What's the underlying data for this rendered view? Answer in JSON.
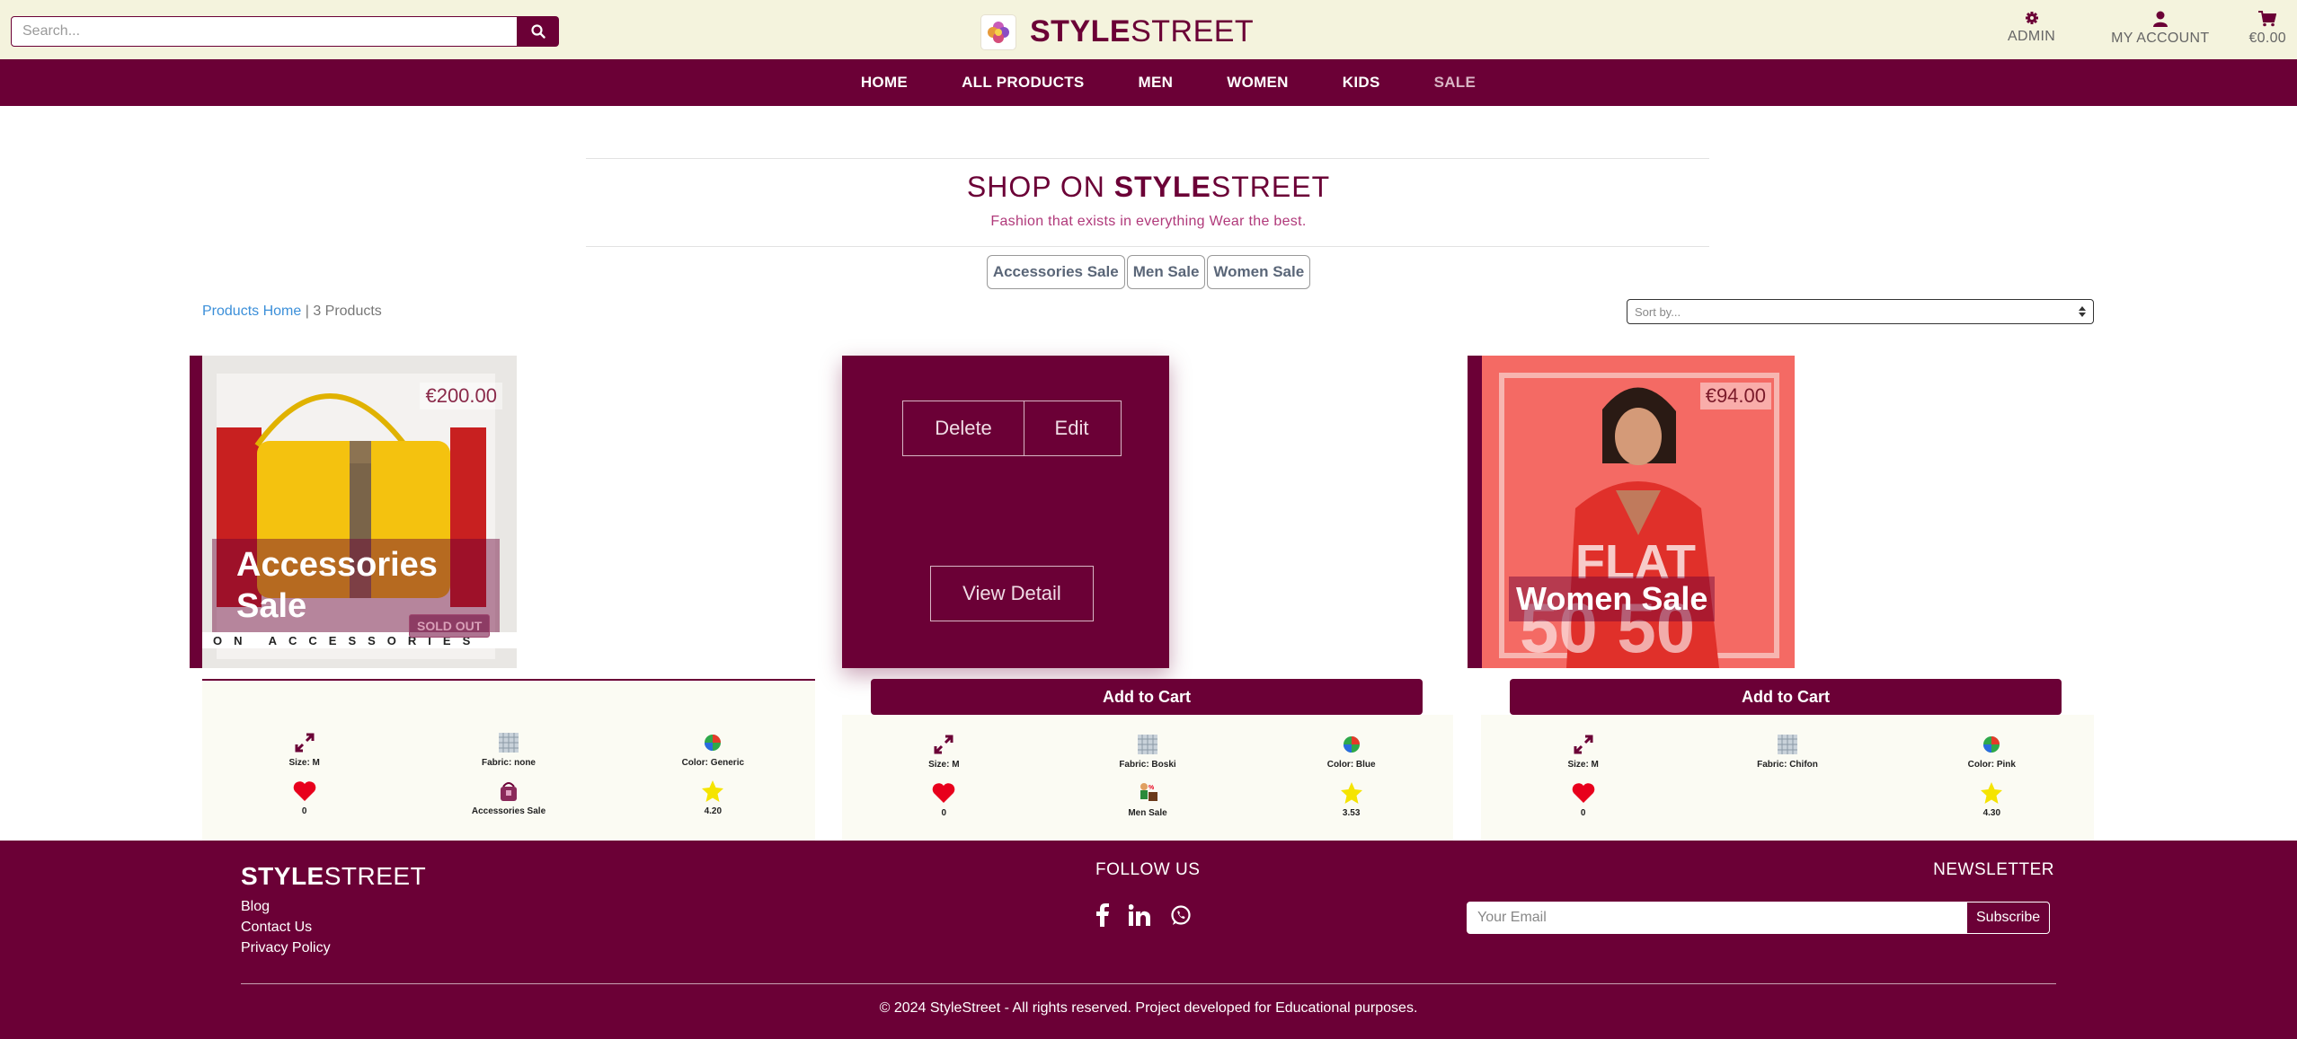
{
  "header": {
    "search_placeholder": "Search...",
    "brand_bold": "STYLE",
    "brand_light": "STREET",
    "links": [
      {
        "label": "ADMIN",
        "icon": "gear-icon"
      },
      {
        "label": "MY ACCOUNT",
        "icon": "user-icon"
      },
      {
        "label": "€0.00",
        "icon": "cart-icon"
      }
    ]
  },
  "nav": {
    "items": [
      "HOME",
      "ALL PRODUCTS",
      "MEN",
      "WOMEN",
      "KIDS",
      "SALE"
    ]
  },
  "shop": {
    "title_prefix": "SHOP ON ",
    "title_bold": "STYLE",
    "title_light": "STREET",
    "subtitle": "Fashion that exists in everything Wear the best.",
    "categories": [
      "Accessories Sale",
      "Men Sale",
      "Women Sale"
    ],
    "breadcrumb_link": "Products Home",
    "breadcrumb_sep": " | ",
    "breadcrumb_count": "3 Products",
    "sort_placeholder": "Sort by..."
  },
  "products": [
    {
      "price": "€200.00",
      "title_line1": "Accessories",
      "title_line2": "Sale",
      "badge": "SOLD OUT",
      "banner_text": "ON ACCESSORIES",
      "size": "Size: M",
      "fabric": "Fabric: none",
      "color": "Color: Generic",
      "likes": "0",
      "category": "Accessories Sale",
      "rating": "4.20"
    },
    {
      "delete_label": "Delete",
      "edit_label": "Edit",
      "view_label": "View Detail",
      "add_to_cart": "Add to Cart",
      "size": "Size: M",
      "fabric": "Fabric: Boski",
      "color": "Color: Blue",
      "likes": "0",
      "category": "Men Sale",
      "rating": "3.53"
    },
    {
      "price": "€94.00",
      "overlay_big": "FLAT",
      "overlay_big2": "50 50",
      "title": "Women Sale",
      "add_to_cart": "Add to Cart",
      "size": "Size: M",
      "fabric": "Fabric: Chifon",
      "color": "Color: Pink",
      "likes": "0",
      "category": "Women Sale",
      "rating": "4.30"
    }
  ],
  "footer": {
    "brand_bold": "STYLE",
    "brand_light": "STREET",
    "links": [
      "Blog",
      "Contact Us",
      "Privacy Policy"
    ],
    "follow": "FOLLOW US",
    "social": [
      "facebook-icon",
      "linkedin-icon",
      "whatsapp-icon"
    ],
    "newsletter": "NEWSLETTER",
    "email_placeholder": "Your Email",
    "subscribe": "Subscribe",
    "copyright": "© 2024 StyleStreet - All rights reserved. Project developed for Educational purposes."
  },
  "colors": {
    "maroon": "#6b0036",
    "cream": "#f4f3dd",
    "link_blue": "#3b8fd9"
  }
}
